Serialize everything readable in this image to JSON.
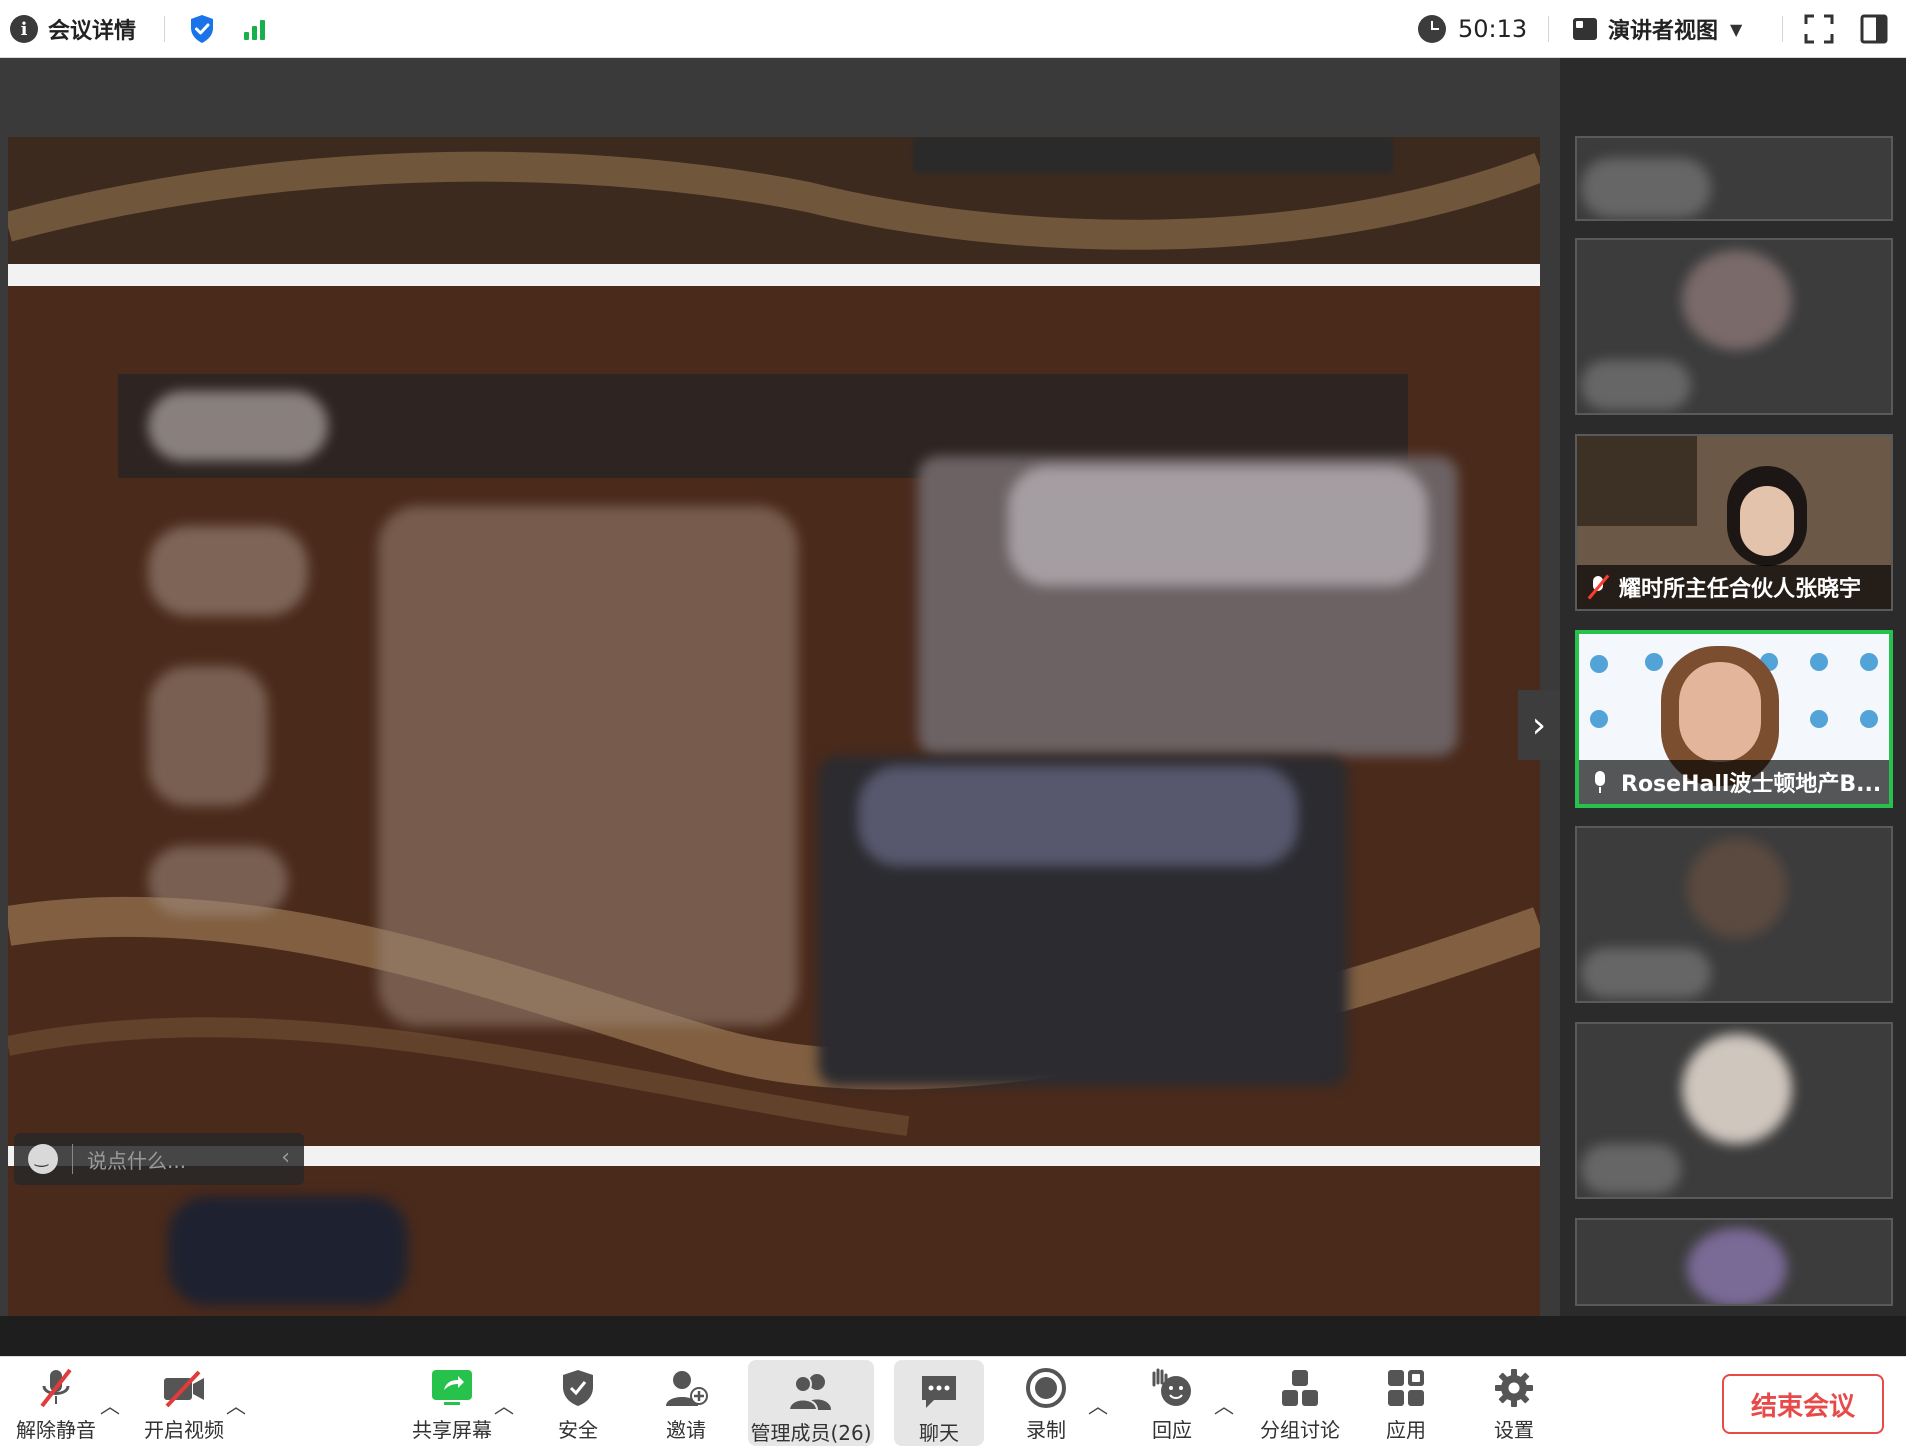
{
  "topbar": {
    "meeting_details_label": "会议详情",
    "timer": "50:13",
    "view_mode_label": "演讲者视图",
    "view_mode_caret": "▼",
    "accent_color": "#1a73e8",
    "signal_color": "#18b04a"
  },
  "chat": {
    "placeholder": "说点什么..."
  },
  "participants": [
    {
      "name": "",
      "muted": true
    },
    {
      "name": "",
      "muted": true
    },
    {
      "name": "耀时所主任合伙人张晓宇",
      "muted": true
    },
    {
      "name": "RoseHall波士顿地产B...",
      "muted": false,
      "active_speaker": true
    },
    {
      "name": "",
      "muted": true
    },
    {
      "name": "",
      "muted": true
    },
    {
      "name": "",
      "muted": true
    }
  ],
  "toolbar": {
    "unmute_label": "解除静音",
    "start_video_label": "开启视频",
    "share_screen_label": "共享屏幕",
    "security_label": "安全",
    "invite_label": "邀请",
    "participants_label": "管理成员(26)",
    "chat_label": "聊天",
    "record_label": "录制",
    "reactions_label": "回应",
    "breakout_label": "分组讨论",
    "apps_label": "应用",
    "settings_label": "设置",
    "end_meeting_label": "结束会议",
    "end_color": "#e84a4a",
    "share_color": "#27c24c"
  }
}
